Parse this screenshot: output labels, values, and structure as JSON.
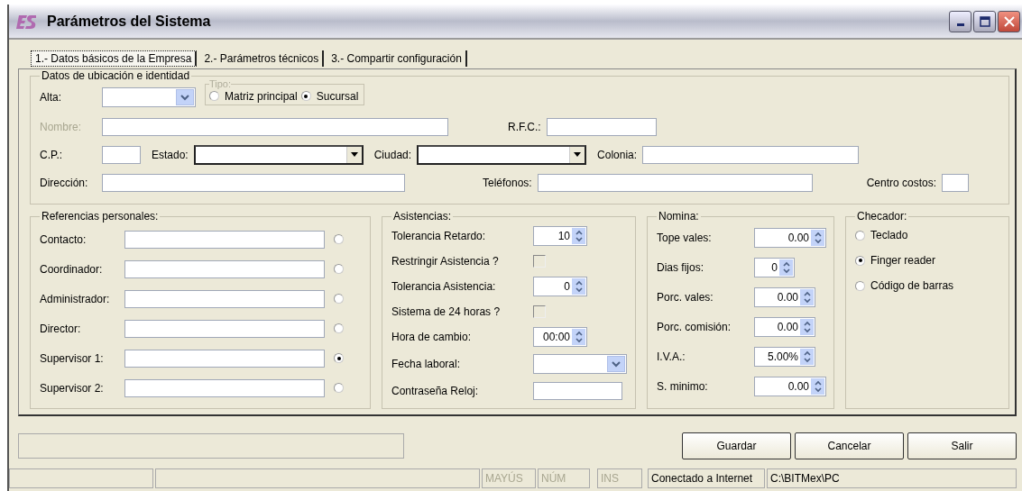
{
  "window": {
    "title": "Parámetros del Sistema"
  },
  "tabs": [
    {
      "label": "1.- Datos básicos de la Empresa",
      "selected": true
    },
    {
      "label": "2.- Parámetros técnicos",
      "selected": false
    },
    {
      "label": "3.- Compartir configuración",
      "selected": false
    }
  ],
  "location": {
    "title": "Datos de ubicación e identidad",
    "alta": {
      "label": "Alta:"
    },
    "tipo": {
      "title": "Tipo:",
      "options": [
        {
          "label": "Matriz principal",
          "selected": false
        },
        {
          "label": "Sucursal",
          "selected": true
        }
      ]
    },
    "rows": [
      [
        {
          "label": "Nombre:",
          "kind": "text",
          "disabled": true
        },
        {
          "label": "R.F.C.:",
          "kind": "text",
          "disabled": false
        }
      ],
      [
        {
          "label": "C.P.:",
          "kind": "text",
          "disabled": false
        },
        {
          "label": "Estado:",
          "kind": "combo",
          "disabled": false
        },
        {
          "label": "Ciudad:",
          "kind": "combo",
          "disabled": false
        },
        {
          "label": "Colonia:",
          "kind": "text",
          "disabled": false
        }
      ],
      [
        {
          "label": "Dirección:",
          "kind": "text",
          "disabled": false
        },
        {
          "label": "Teléfonos:",
          "kind": "text",
          "disabled": false
        },
        {
          "label": "Centro costos:",
          "kind": "text",
          "disabled": false
        }
      ]
    ]
  },
  "references": {
    "title": "Referencias personales:",
    "rows": [
      {
        "label": "Contacto:",
        "selected": false
      },
      {
        "label": "Coordinador:",
        "selected": false
      },
      {
        "label": "Administrador:",
        "selected": false
      },
      {
        "label": "Director:",
        "selected": false
      },
      {
        "label": "Supervisor 1:",
        "selected": true
      },
      {
        "label": "Supervisor 2:",
        "selected": false
      }
    ]
  },
  "attendance": {
    "title": "Asistencias:",
    "rows": [
      {
        "label": "Tolerancia Retardo:",
        "kind": "spin",
        "value": "10"
      },
      {
        "label": "Restringir Asistencia ?",
        "kind": "check",
        "checked": false
      },
      {
        "label": "Tolerancia Asistencia:",
        "kind": "spin",
        "value": "0"
      },
      {
        "label": "Sistema de 24 horas ?",
        "kind": "check",
        "checked": false
      },
      {
        "label": "Hora de cambio:",
        "kind": "spin",
        "value": "00:00"
      },
      {
        "label": "Fecha laboral:",
        "kind": "combo"
      },
      {
        "label": "Contraseña Reloj:",
        "kind": "text"
      }
    ]
  },
  "payroll": {
    "title": "Nomina:",
    "rows": [
      {
        "label": "Tope vales:",
        "value": "0.00"
      },
      {
        "label": "Dias fijos:",
        "value": "0"
      },
      {
        "label": "Porc. vales:",
        "value": "0.00"
      },
      {
        "label": "Porc. comisión:",
        "value": "0.00"
      },
      {
        "label": "I.V.A.:",
        "value": "5.00%"
      },
      {
        "label": "S. minimo:",
        "value": "0.00"
      }
    ]
  },
  "clock": {
    "title": "Checador:",
    "options": [
      {
        "label": "Teclado",
        "selected": false
      },
      {
        "label": "Finger reader",
        "selected": true
      },
      {
        "label": "Código de barras",
        "selected": false
      }
    ]
  },
  "buttons": [
    "Guardar",
    "Cancelar",
    "Salir"
  ],
  "status_bar": [
    {
      "text": "MAYÚS",
      "disabled": true
    },
    {
      "text": "NÚM",
      "disabled": true
    },
    {
      "text": "INS",
      "disabled": true
    },
    {
      "text": "Conectado a Internet",
      "disabled": false
    },
    {
      "text": "C:\\BITMex\\PC",
      "disabled": false
    }
  ]
}
